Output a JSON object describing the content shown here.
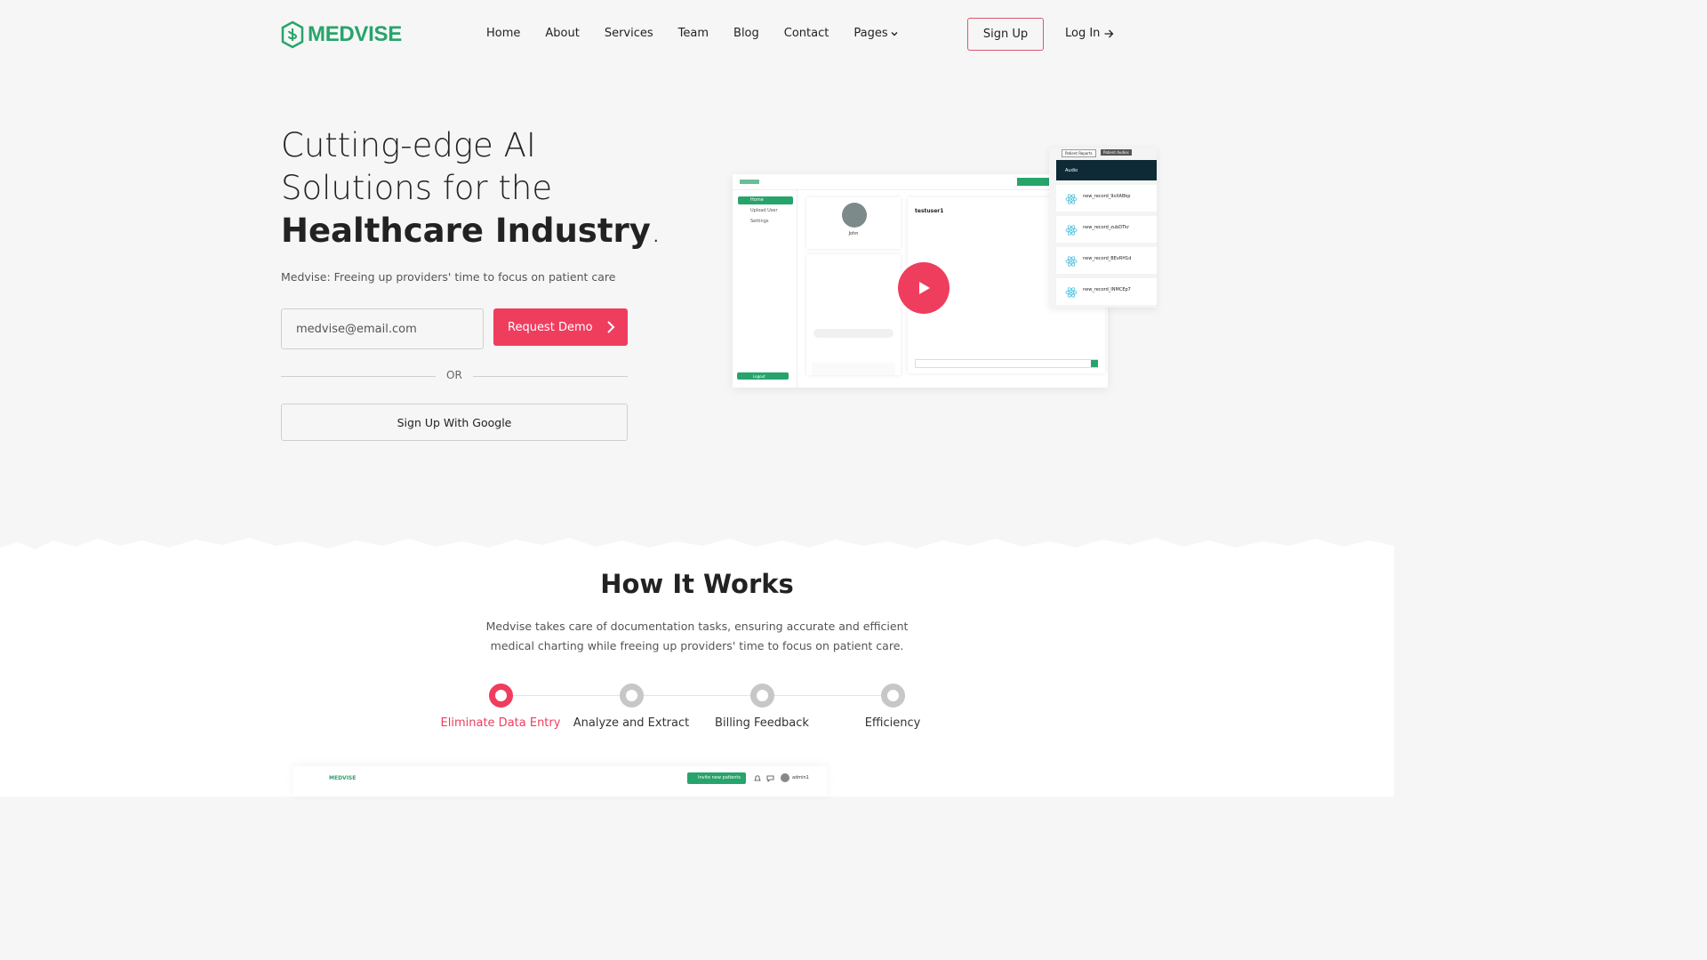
{
  "brand": {
    "name": "MEDVISE",
    "color": "#27a46b",
    "accent": "#ef3d5e"
  },
  "nav": {
    "links": [
      "Home",
      "About",
      "Services",
      "Team",
      "Blog",
      "Contact"
    ],
    "pages_label": "Pages",
    "signup_label": "Sign Up",
    "login_label": "Log In"
  },
  "hero": {
    "title_line1": "Cutting-edge AI",
    "title_line2": "Solutions for the",
    "title_bold": "Healthcare Industry",
    "title_end": ".",
    "subtitle": "Medvise: Freeing up providers' time to focus on patient care",
    "email_placeholder": "medvise@email.com",
    "demo_label": "Request Demo",
    "or_label": "OR",
    "google_label": "Sign Up With Google"
  },
  "mockup": {
    "sidebar": [
      "Home",
      "Upload User",
      "Settings"
    ],
    "logout_label": "Logout",
    "profile_name": "John",
    "chat_user": "testuser1",
    "tabs": [
      "Patient Reports",
      "Patient Audios"
    ],
    "panel_title": "Audio",
    "records": [
      "new_record_9sXABkp",
      "new_record_zubDTkr",
      "new_record_BEvRH1d",
      "new_record_INMCEp7"
    ]
  },
  "how": {
    "title_light": "How",
    "title_bold": "It Works",
    "desc": "Medvise takes care of documentation tasks, ensuring accurate and efficient medical charting while freeing up providers' time to focus on patient care.",
    "steps": [
      "Eliminate Data Entry",
      "Analyze and Extract",
      "Billing Feedback",
      "Efficiency"
    ],
    "active_step": 0
  },
  "bottom_mock": {
    "logo": "MEDVISE",
    "invite_label": "Invite new patients",
    "user": "admin1"
  }
}
